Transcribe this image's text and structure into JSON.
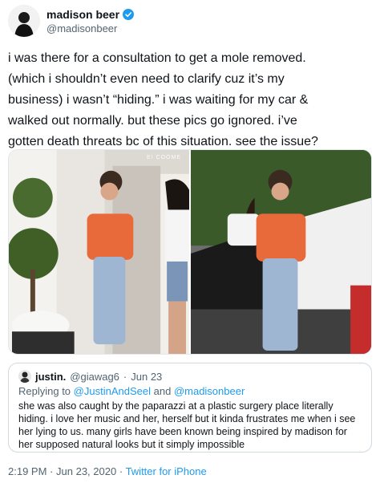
{
  "author": {
    "name": "madison beer",
    "handle": "@madisonbeer"
  },
  "tweet": {
    "lines": [
      "i was there for a consultation to get a mole removed.",
      "(which i shouldn’t even need to clarify cuz it’s my",
      "business) i wasn’t “hiding.” i was waiting for my car &",
      "walked out normally. but these pics go ignored. i’ve",
      "gotten death threats bc of this situation. see the issue?"
    ]
  },
  "media": {
    "watermark": "E! COOME"
  },
  "quote": {
    "name": "justin.",
    "handle": "@giawag6",
    "separator": "·",
    "date": "Jun 23",
    "replying_prefix": "Replying to",
    "replying_to_1": "@JustinAndSeel",
    "replying_and": "and",
    "replying_to_2": "@madisonbeer",
    "lines": [
      "she was also caught by the paparazzi at a plastic surgery place literally",
      "hiding. i love her music and her, herself but it kinda frustrates me when i see",
      "her lying to us. many girls have been known being inspired by madison for",
      "her supposed natural looks but it simply impossible"
    ]
  },
  "footer": {
    "time": "2:19 PM",
    "separator1": "·",
    "date": "Jun 23, 2020",
    "separator2": "·",
    "source": "Twitter for iPhone"
  },
  "colors": {
    "accent": "#1d9bf0",
    "text": "#0f1419",
    "muted": "#536471"
  },
  "icons": {
    "verified": "verified-badge-icon"
  }
}
